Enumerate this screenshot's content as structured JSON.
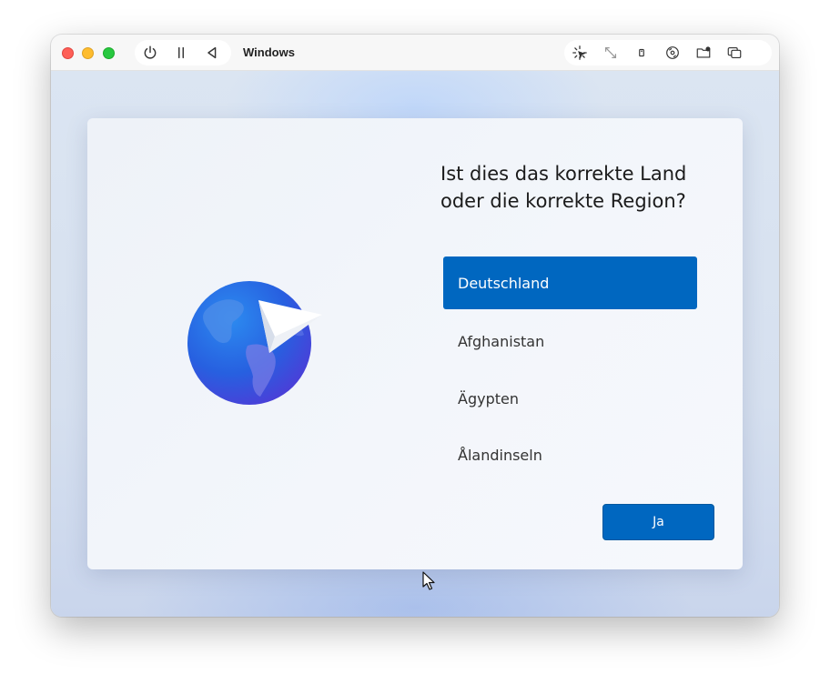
{
  "window": {
    "title": "Windows"
  },
  "toolbar": {
    "left_icons": [
      "power-icon",
      "pause-icon",
      "back-icon"
    ],
    "right_icons": [
      "cursor-capture-icon",
      "fullscreen-icon",
      "usb-icon",
      "cd-icon",
      "shared-folder-icon",
      "windows-icon"
    ]
  },
  "setup": {
    "headline": "Ist dies das korrekte Land\noder die korrekte Region?",
    "countries": [
      {
        "label": "Deutschland",
        "selected": true
      },
      {
        "label": "Afghanistan",
        "selected": false
      },
      {
        "label": "Ägypten",
        "selected": false
      },
      {
        "label": "Ålandinseln",
        "selected": false
      }
    ],
    "confirm_label": "Ja"
  },
  "tray": {
    "icons": [
      "accessibility-icon",
      "volume-icon"
    ]
  },
  "colors": {
    "accent": "#0067c0",
    "traffic_close": "#fe5f57",
    "traffic_min": "#febc2e",
    "traffic_max": "#28c840"
  }
}
